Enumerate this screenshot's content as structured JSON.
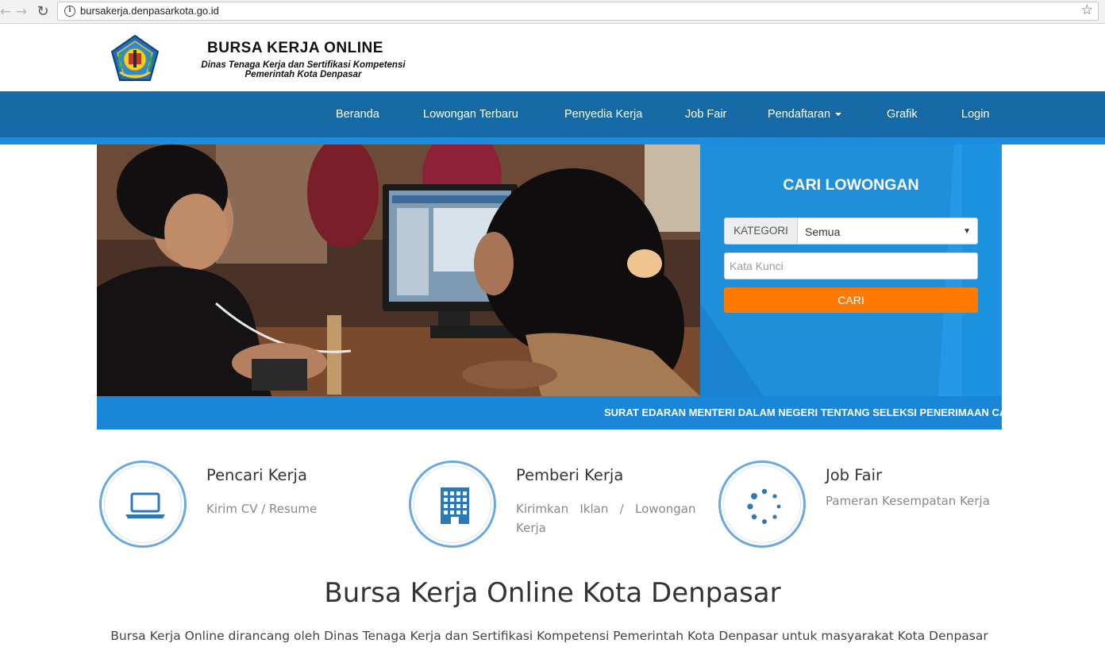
{
  "browser": {
    "url": "bursakerja.denpasarkota.go.id",
    "back_icon": "arrow-left-icon",
    "forward_icon": "arrow-right-icon",
    "reload_icon": "reload-icon",
    "star_icon": "star-icon"
  },
  "header": {
    "title": "BURSA KERJA ONLINE",
    "subtitle_line1": "Dinas Tenaga Kerja dan Sertifikasi Kompetensi",
    "subtitle_line2": "Pemerintah Kota Denpasar"
  },
  "nav": {
    "items": [
      {
        "label": "Beranda"
      },
      {
        "label": "Lowongan Terbaru"
      },
      {
        "label": "Penyedia Kerja"
      },
      {
        "label": "Job Fair"
      },
      {
        "label": "Pendaftaran"
      },
      {
        "label": "Grafik"
      },
      {
        "label": "Login"
      }
    ]
  },
  "search": {
    "title": "CARI LOWONGAN",
    "category_label": "KATEGORI",
    "category_value": "Semua",
    "keyword_placeholder": "Kata Kunci",
    "button_label": "CARI"
  },
  "marquee": {
    "text": "SURAT EDARAN MENTERI DALAM NEGERI TENTANG SELEKSI PENERIMAAN CA"
  },
  "features": [
    {
      "title": "Pencari Kerja",
      "desc": "Kirim CV / Resume",
      "icon": "laptop-icon"
    },
    {
      "title": "Pemberi Kerja",
      "desc_line1": "Kirimkan   Iklan   /   Lowongan",
      "desc_line2": "Kerja",
      "icon": "building-icon"
    },
    {
      "title": "Job Fair",
      "desc": "Pameran Kesempatan Kerja",
      "icon": "spinner-icon"
    }
  ],
  "main": {
    "title": "Bursa Kerja Online Kota Denpasar",
    "text": "Bursa Kerja Online dirancang oleh Dinas Tenaga Kerja dan Sertifikasi Kompetensi Pemerintah Kota Denpasar untuk masyarakat Kota Denpasar yang"
  },
  "colors": {
    "nav_bg": "#1569a5",
    "nav_accent": "#1a8de0",
    "search_bg": "#1f8fdc",
    "button": "#ff7a00",
    "circle_border": "#6aa8e4",
    "icon": "#2f78b8"
  }
}
